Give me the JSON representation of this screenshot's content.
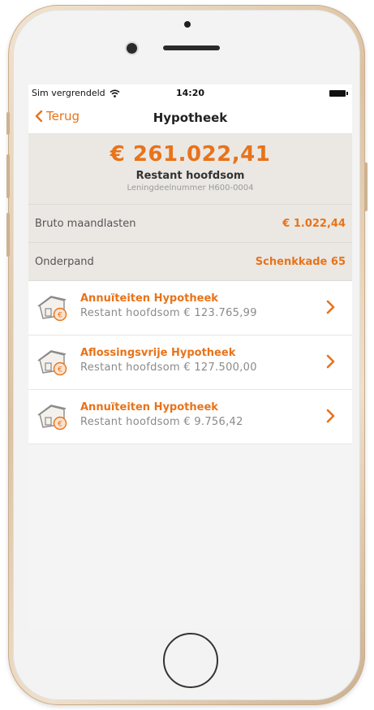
{
  "status": {
    "carrier": "Sim vergrendeld",
    "time": "14:20"
  },
  "nav": {
    "back_label": "Terug",
    "title": "Hypotheek"
  },
  "summary": {
    "amount": "€ 261.022,41",
    "label": "Restant hoofdsom",
    "loan_number": "Leningdeelnummer H600-0004"
  },
  "rows": {
    "bruto": {
      "label": "Bruto maandlasten",
      "value": "€ 1.022,44"
    },
    "onderpand": {
      "label": "Onderpand",
      "value": "Schenkkade 65"
    }
  },
  "items": [
    {
      "title": "Annuïteiten Hypotheek",
      "subtitle": "Restant hoofdsom € 123.765,99"
    },
    {
      "title": "Aflossingsvrije Hypotheek",
      "subtitle": "Restant hoofdsom € 127.500,00"
    },
    {
      "title": "Annuïteiten Hypotheek",
      "subtitle": "Restant hoofdsom € 9.756,42"
    }
  ],
  "colors": {
    "accent": "#e8731a",
    "header_bg": "#ebe8e4"
  },
  "icons": {
    "wifi": "wifi-icon",
    "battery": "battery-icon",
    "back": "chevron-left-icon",
    "house": "house-euro-icon",
    "chevron": "chevron-right-icon"
  }
}
